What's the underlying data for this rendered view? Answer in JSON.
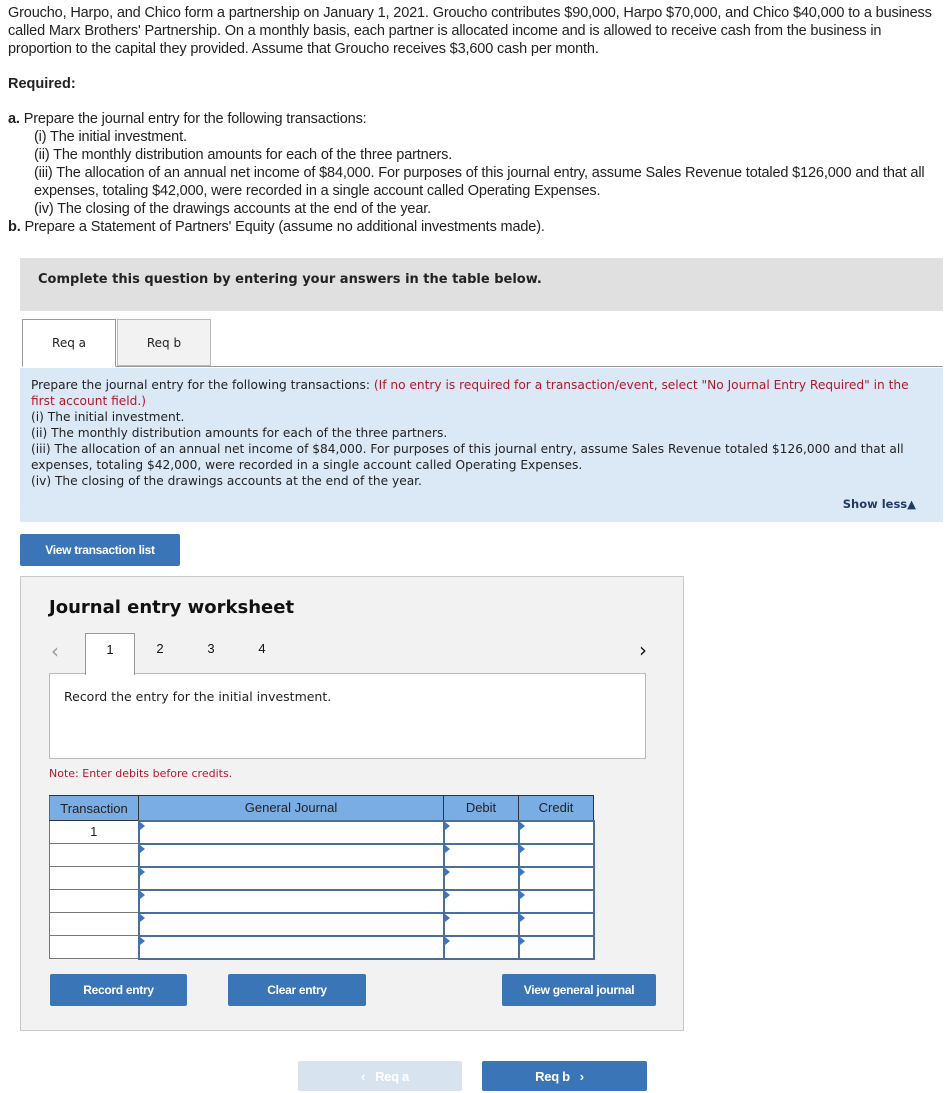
{
  "intro": "Groucho, Harpo, and Chico form a partnership on January 1, 2021. Groucho contributes $90,000, Harpo $70,000, and Chico $40,000 to a business called Marx Brothers' Partnership. On a monthly basis, each partner is allocated income and is allowed to receive cash from the business in proportion to the capital they provided. Assume that Groucho receives $3,600 cash per month.",
  "required": {
    "label": "Required:",
    "a_prefix": "a.",
    "a_text": "Prepare the journal entry for the following transactions:",
    "items": [
      "(i) The initial investment.",
      "(ii) The monthly distribution amounts for each of the three partners.",
      "(iii) The allocation of an annual net income of $84,000. For purposes of this journal entry, assume Sales Revenue totaled $126,000 and that all expenses, totaling $42,000, were recorded in a single account called Operating Expenses.",
      "(iv) The closing of the drawings accounts at the end of the year."
    ],
    "b_prefix": "b.",
    "b_text": "Prepare a Statement of Partners' Equity (assume no additional investments made)."
  },
  "complete_bar": "Complete this question by entering your answers in the table below.",
  "tabs": [
    {
      "label": "Req a",
      "active": true
    },
    {
      "label": "Req b",
      "active": false
    }
  ],
  "instructions": {
    "lead": "Prepare the journal entry for the following transactions:",
    "red_note": "(If no entry is required for a transaction/event, select \"No Journal Entry Required\" in the first account field.)",
    "items": [
      "(i) The initial investment.",
      "(ii) The monthly distribution amounts for each of the three partners.",
      "(iii) The allocation of an annual net income of $84,000. For purposes of this journal entry, assume Sales Revenue totaled $126,000 and that all expenses, totaling $42,000, were recorded in a single account called Operating Expenses.",
      "(iv) The closing of the drawings accounts at the end of the year."
    ],
    "show_less": "Show less▲"
  },
  "buttons": {
    "view_transaction_list": "View transaction list",
    "record_entry": "Record entry",
    "clear_entry": "Clear entry",
    "view_general_journal": "View general journal"
  },
  "worksheet": {
    "title": "Journal entry worksheet",
    "prev_icon": "‹",
    "next_icon": "›",
    "pages": [
      "1",
      "2",
      "3",
      "4"
    ],
    "active_page": "1",
    "prompt": "Record the entry for the initial investment.",
    "note": "Note: Enter debits before credits.",
    "columns": [
      "Transaction",
      "General Journal",
      "Debit",
      "Credit"
    ],
    "rows": [
      {
        "transaction": "1",
        "account": "",
        "debit": "",
        "credit": ""
      },
      {
        "transaction": "",
        "account": "",
        "debit": "",
        "credit": ""
      },
      {
        "transaction": "",
        "account": "",
        "debit": "",
        "credit": ""
      },
      {
        "transaction": "",
        "account": "",
        "debit": "",
        "credit": ""
      },
      {
        "transaction": "",
        "account": "",
        "debit": "",
        "credit": ""
      },
      {
        "transaction": "",
        "account": "",
        "debit": "",
        "credit": ""
      }
    ]
  },
  "nav": {
    "prev_label": "Req a",
    "next_label": "Req b",
    "prev_icon": "‹",
    "next_icon": "›"
  }
}
